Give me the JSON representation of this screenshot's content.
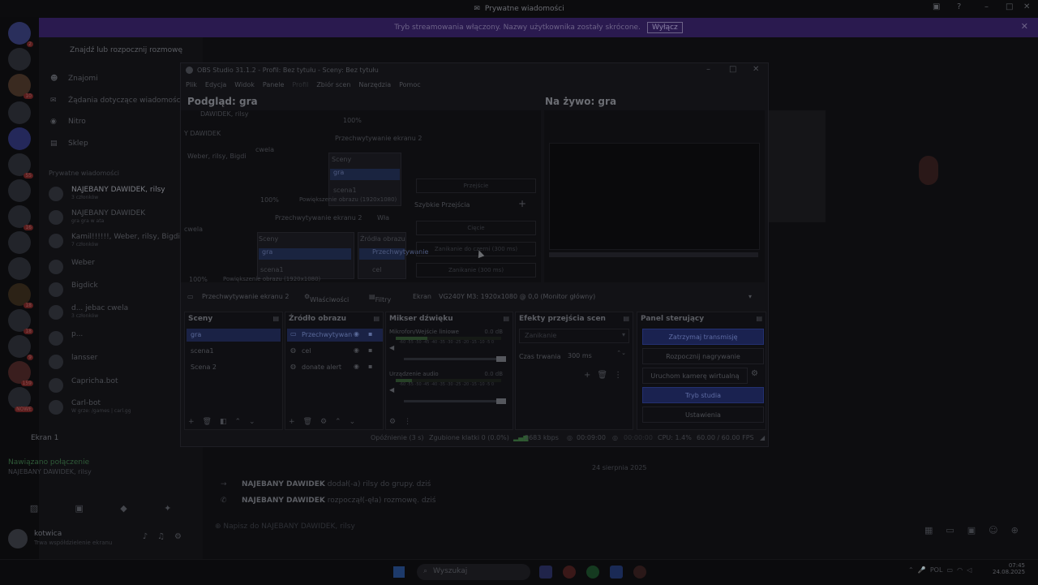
{
  "discord": {
    "window_title": "Prywatne wiadomości",
    "banner_text": "Tryb streamowania włączony. Nazwy użytkownika zostały skrócone.",
    "banner_button": "Wyłącz",
    "search_placeholder": "Znajdź lub rozpocznij rozmowę",
    "nav": [
      {
        "label": "Znajomi",
        "icon": "friends-icon"
      },
      {
        "label": "Żądania dotyczące wiadomości",
        "icon": "inbox-icon"
      },
      {
        "label": "Nitro",
        "icon": "nitro-icon"
      },
      {
        "label": "Sklep",
        "icon": "shop-icon"
      }
    ],
    "dm_header": "Prywatne wiadomości",
    "dms": [
      {
        "name": "NAJEBANY DAWIDEK, rilsy",
        "sub": "3 członków",
        "active": true
      },
      {
        "name": "NAJEBANY DAWIDEK",
        "sub": "gra gra w ata",
        "active": false
      },
      {
        "name": "Kamil!!!!!!, Weber, rilsy, Bigdi",
        "sub": "7 członków",
        "active": false
      },
      {
        "name": "Weber",
        "sub": "",
        "active": false
      },
      {
        "name": "Bigdick",
        "sub": "",
        "active": false
      },
      {
        "name": "d... jebac cwela",
        "sub": "3 członków",
        "active": false
      },
      {
        "name": "p...",
        "sub": "",
        "active": false
      },
      {
        "name": "lansser",
        "sub": "",
        "active": false
      },
      {
        "name": "Capricha.bot",
        "sub": "",
        "active": false
      },
      {
        "name": "Carl-bot",
        "sub": "W grze: /games | carl.gg",
        "active": false
      }
    ],
    "screen_label": "Ekran 1",
    "voice_status": "Nawiązano połączenie",
    "voice_channel": "NAJEBANY DAWIDEK, rilsy",
    "user_name": "kotwica",
    "user_status": "Trwa współdzielenie ekranu",
    "chat_date": "24 sierpnia 2025",
    "chat_lines": [
      {
        "name": "NAJEBANY DAWIDEK",
        "text": "dodał(-a) rilsy do grupy. dziś",
        "icon": "arrow-icon"
      },
      {
        "name": "NAJEBANY DAWIDEK",
        "text": "rozpoczął(-ęła) rozmowę. dziś",
        "icon": "phone-icon"
      }
    ],
    "composer_placeholder": "Napisz do NAJEBANY DAWIDEK, rilsy",
    "server_badges": [
      "2",
      "10",
      "55",
      "16",
      "18",
      "18",
      "9",
      "159",
      "NOWE"
    ]
  },
  "obs": {
    "title": "OBS Studio 31.1.2 - Profil: Bez tytułu - Sceny: Bez tytułu",
    "menu": [
      "Plik",
      "Edycja",
      "Widok",
      "Panele",
      "Profil",
      "Zbiór scen",
      "Narzędzia",
      "Pomoc"
    ],
    "preview_label": "Podgląd: gra",
    "live_label": "Na żywo: gra",
    "nested": {
      "capture_label": "Przechwytywanie ekranu 2",
      "scenes": "Sceny",
      "sources": "Źródła obrazu",
      "scene_gra": "gra",
      "scene_1": "scena1",
      "zoom": "100%",
      "resolution": "Powiększenie obrazu (1920x1080)",
      "chat_bits": [
        "Y DAWIDEK",
        "Weber, rilsy, Bigdi",
        "cwela",
        "DAWIDEK, rilsy",
        "cwela"
      ],
      "capture_short": "Przechwytywanie",
      "props_short": "Wła",
      "src_cel": "cel"
    },
    "transition_panel": {
      "transition": "Przejście",
      "quick": "Szybkie Przejścia",
      "cut": "Cięcie",
      "fade_black": "Zanikanie do czerni (300 ms)",
      "fade": "Zanikanie (300 ms)"
    },
    "source_bar": {
      "source": "Przechwytywanie ekranu 2",
      "properties": "Właściwości",
      "filters": "Filtry",
      "screen_label": "Ekran",
      "screen_value": "VG240Y M3: 1920x1080 @ 0,0 (Monitor główny)"
    },
    "docks": {
      "scenes": {
        "title": "Sceny",
        "items": [
          "gra",
          "scena1",
          "Scena 2"
        ],
        "selected": 0
      },
      "sources": {
        "title": "Źródło obrazu",
        "items": [
          "Przechwytywan",
          "cel",
          "donate alert"
        ],
        "selected": 0
      },
      "mixer": {
        "title": "Mikser dźwięku",
        "channels": [
          {
            "name": "Mikrofon/Wejście liniowe",
            "db": "0.0 dB",
            "scale": "-60 -55 -50 -45 -40 -35 -30 -25 -20 -15 -10 -5 0",
            "level": 0.3
          },
          {
            "name": "Urządzenie audio",
            "db": "0.0 dB",
            "scale": "-60 -55 -50 -45 -40 -35 -30 -25 -20 -15 -10 -5 0",
            "level": 0.15
          }
        ]
      },
      "transitions": {
        "title": "Efekty przejścia scen",
        "select": "Zanikanie",
        "duration_label": "Czas trwania",
        "duration_value": "300 ms"
      },
      "controls": {
        "title": "Panel sterujący",
        "buttons": [
          "Zatrzymaj transmisję",
          "Rozpocznij nagrywanie",
          "Uruchom kamerę wirtualną",
          "Tryb studia",
          "Ustawienia"
        ]
      }
    },
    "status": {
      "delay": "Opóźnienie (3 s)",
      "dropped": "Zgubione klatki 0 (0.0%)",
      "bitrate": "2683 kbps",
      "stream_time": "00:09:00",
      "rec_time": "00:00:00",
      "cpu": "CPU: 1.4%",
      "fps": "60.00 / 60.00 FPS"
    }
  },
  "taskbar": {
    "search_placeholder": "Wyszukaj",
    "tray_lang": "POL",
    "time": "07:45",
    "date": "24.08.2025"
  }
}
